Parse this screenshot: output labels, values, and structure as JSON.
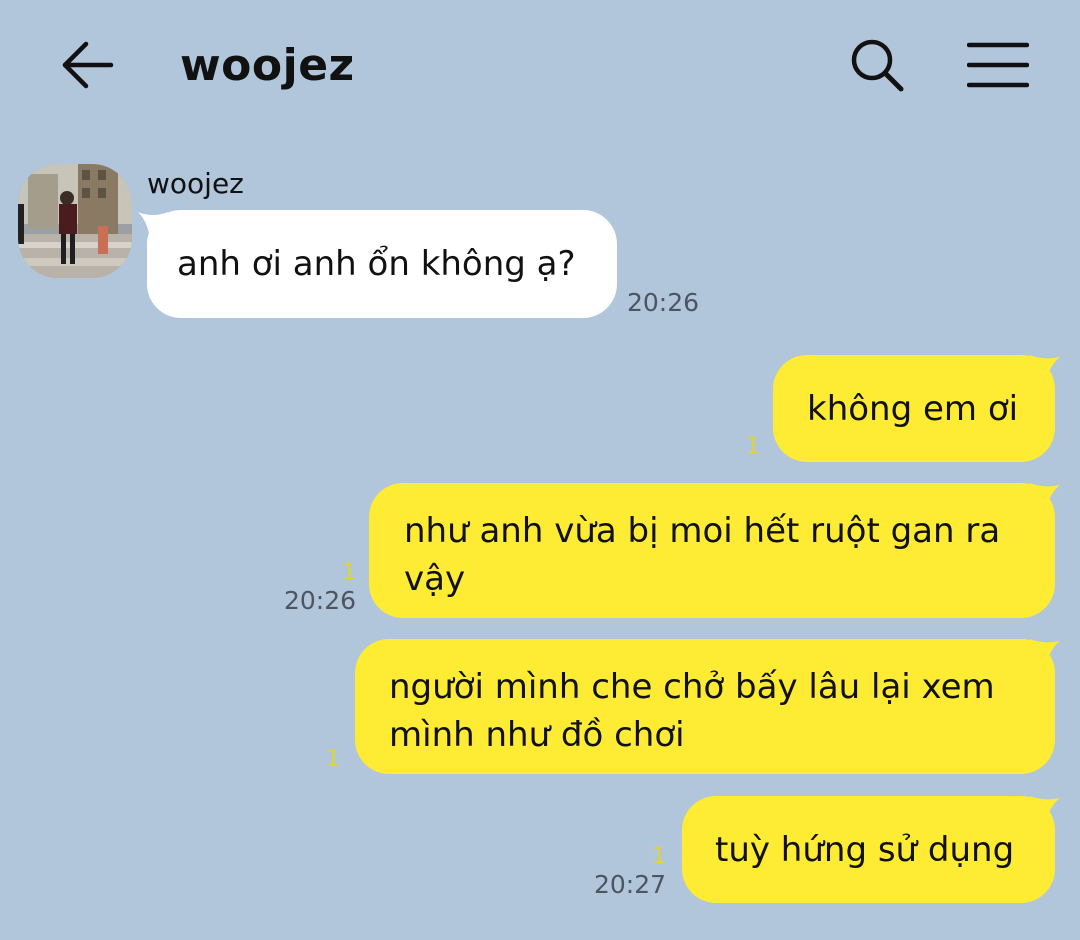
{
  "header": {
    "title": "woojez",
    "back_icon": "arrow-left-icon",
    "search_icon": "search-icon",
    "menu_icon": "hamburger-menu-icon"
  },
  "theme": {
    "background": "#B1C6DB",
    "incoming_bubble": "#FFFFFF",
    "outgoing_bubble": "#FEEB33",
    "unread_color": "#E3D42A"
  },
  "messages": [
    {
      "direction": "incoming",
      "sender": "woojez",
      "text": "anh ơi anh ổn không ạ?",
      "time": "20:26"
    },
    {
      "direction": "outgoing",
      "text": "không em ơi",
      "unread": "1",
      "time": ""
    },
    {
      "direction": "outgoing",
      "text": "như anh vừa bị moi hết ruột gan ra vậy",
      "unread": "1",
      "time": "20:26"
    },
    {
      "direction": "outgoing",
      "text": "người mình che chở bấy lâu lại xem mình như đồ chơi",
      "unread": "1",
      "time": ""
    },
    {
      "direction": "outgoing",
      "text": "tuỳ hứng sử dụng",
      "unread": "1",
      "time": "20:27"
    }
  ]
}
